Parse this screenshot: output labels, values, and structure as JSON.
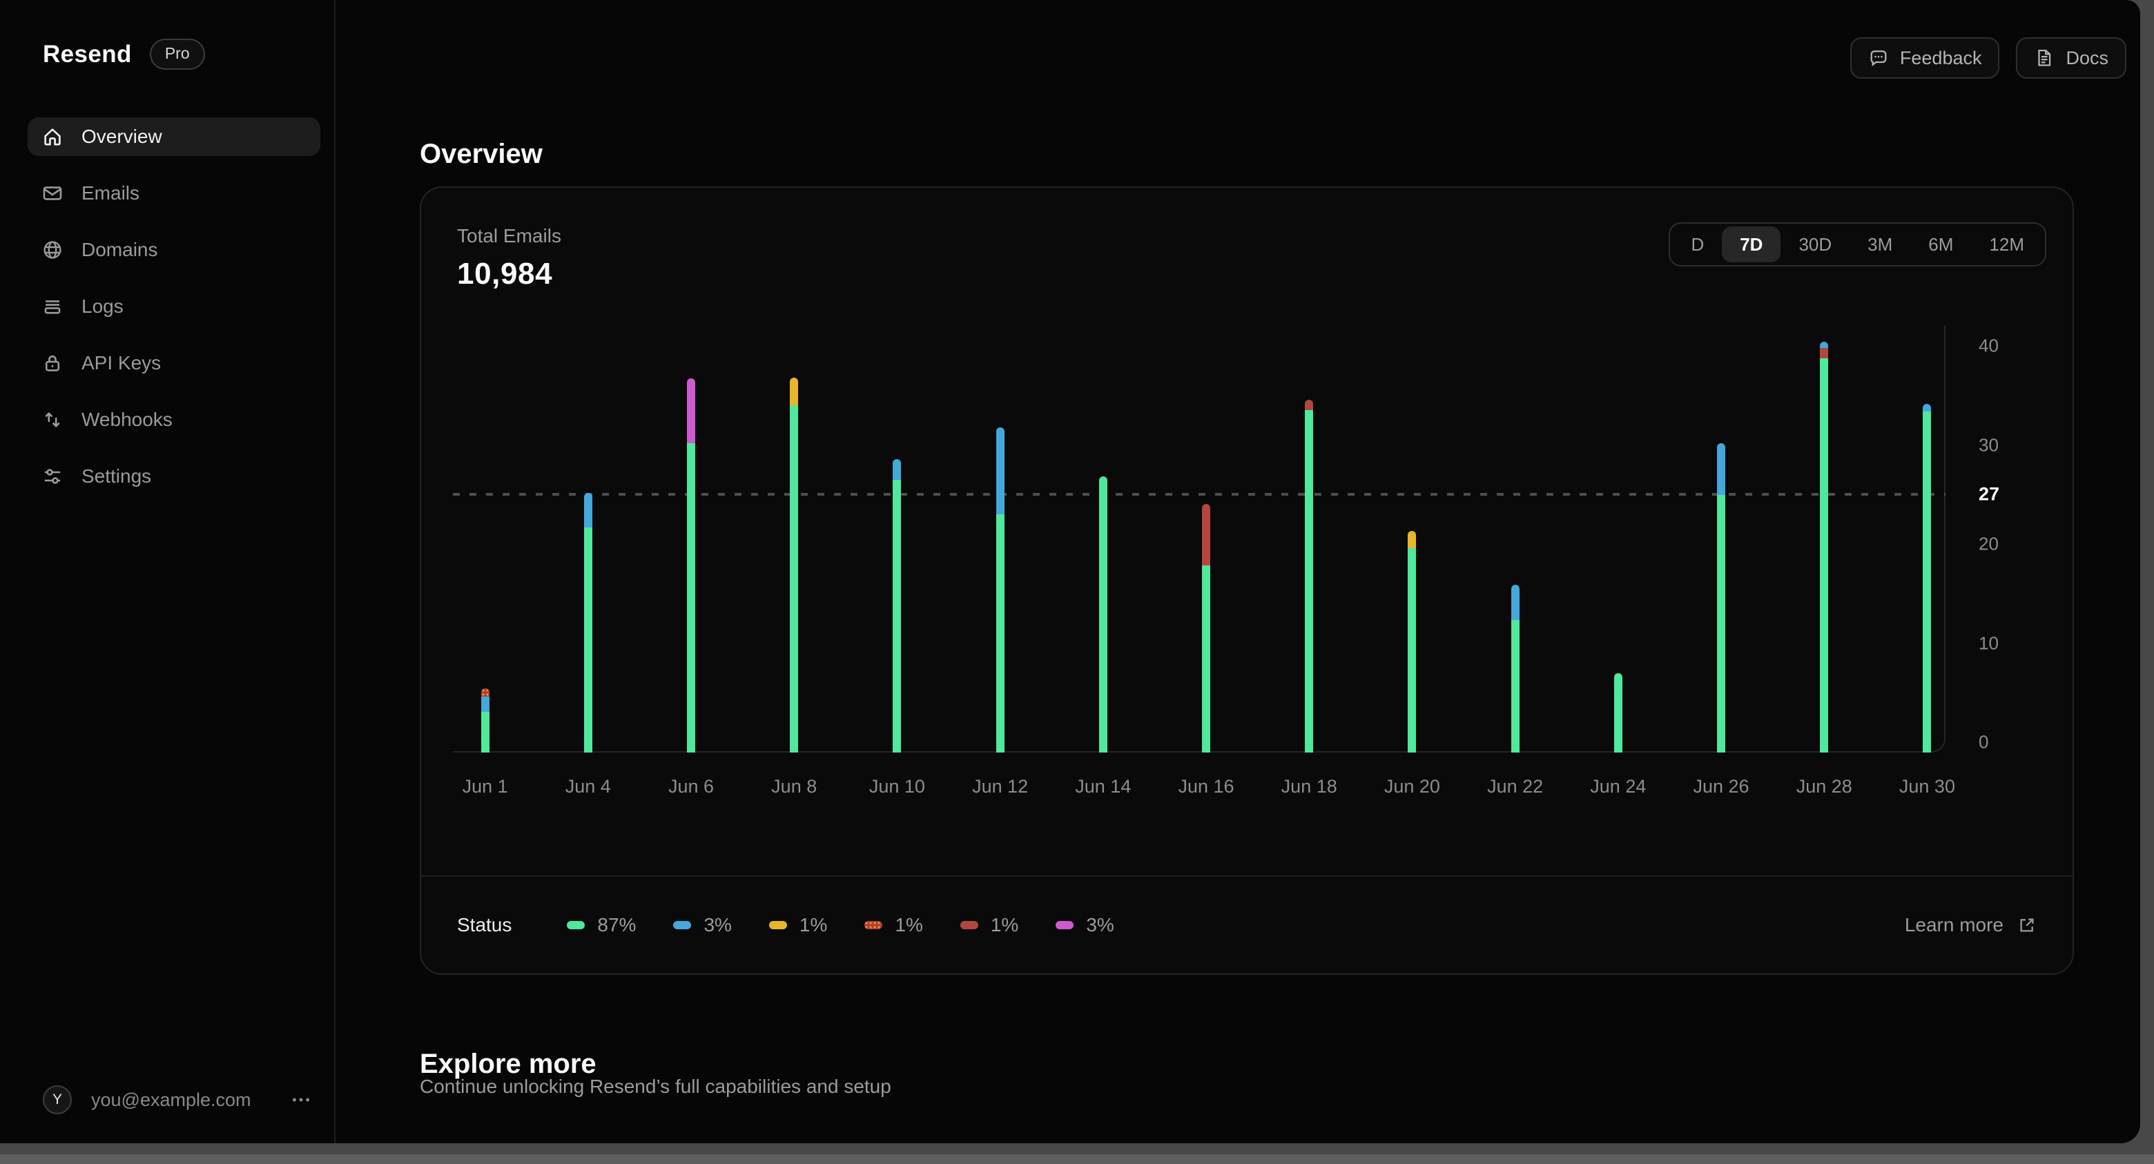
{
  "sidebar": {
    "logo": "Resend",
    "badge": "Pro",
    "items": [
      {
        "label": "Overview",
        "icon": "home-icon",
        "selected": true
      },
      {
        "label": "Emails",
        "icon": "mail-icon",
        "selected": false
      },
      {
        "label": "Domains",
        "icon": "globe-icon",
        "selected": false
      },
      {
        "label": "Logs",
        "icon": "logs-icon",
        "selected": false
      },
      {
        "label": "API Keys",
        "icon": "lock-icon",
        "selected": false
      },
      {
        "label": "Webhooks",
        "icon": "arrows-up-down-icon",
        "selected": false
      },
      {
        "label": "Settings",
        "icon": "sliders-icon",
        "selected": false
      }
    ],
    "user": {
      "avatar_initial": "Y",
      "email": "you@example.com"
    }
  },
  "header": {
    "feedback_label": "Feedback",
    "docs_label": "Docs"
  },
  "page": {
    "title": "Overview"
  },
  "overview_card": {
    "metric_label": "Total Emails",
    "metric_value": "10,984",
    "ranges": [
      {
        "label": "D",
        "selected": false
      },
      {
        "label": "7D",
        "selected": true
      },
      {
        "label": "30D",
        "selected": false
      },
      {
        "label": "3M",
        "selected": false
      },
      {
        "label": "6M",
        "selected": false
      },
      {
        "label": "12M",
        "selected": false
      }
    ],
    "legend": {
      "title": "Status",
      "entries": [
        {
          "color_key": "green",
          "pct": "87%"
        },
        {
          "color_key": "blue",
          "pct": "3%"
        },
        {
          "color_key": "yellow",
          "pct": "1%"
        },
        {
          "color_key": "orange",
          "pct": "1%"
        },
        {
          "color_key": "red",
          "pct": "1%"
        },
        {
          "color_key": "magenta",
          "pct": "3%"
        }
      ],
      "learn_more": "Learn more"
    }
  },
  "explore": {
    "title": "Explore more",
    "subtitle": "Continue unlocking Resend’s full capabilities and setup"
  },
  "chart_data": {
    "type": "bar",
    "stacked": true,
    "title": "Total Emails",
    "total": 10984,
    "ylim": [
      0,
      40
    ],
    "y_ticks": [
      0,
      10,
      20,
      30,
      40
    ],
    "reference_line_value": 27,
    "grid": "dashed-reference-only",
    "legend_position": "bottom",
    "colors": {
      "green": "#4fe89c",
      "blue": "#44a8da",
      "yellow": "#e8b62c",
      "orange": "#b0402c",
      "red": "#b3473e",
      "magenta": "#cd5ad0"
    },
    "bars": [
      {
        "label": "Jun 1",
        "segments": [
          {
            "c": "green",
            "v": 4
          },
          {
            "c": "blue",
            "v": 1.5
          },
          {
            "c": "orange",
            "v": 0.75
          }
        ]
      },
      {
        "label": "Jun 4",
        "segments": [
          {
            "c": "green",
            "v": 22
          },
          {
            "c": "blue",
            "v": 3.4
          }
        ]
      },
      {
        "label": "Jun 6",
        "segments": [
          {
            "c": "green",
            "v": 30.3
          },
          {
            "c": "magenta",
            "v": 6.3
          }
        ]
      },
      {
        "label": "Jun 8",
        "segments": [
          {
            "c": "green",
            "v": 34
          },
          {
            "c": "yellow",
            "v": 2.7
          }
        ]
      },
      {
        "label": "Jun 10",
        "segments": [
          {
            "c": "green",
            "v": 26.7
          },
          {
            "c": "blue",
            "v": 2
          }
        ]
      },
      {
        "label": "Jun 12",
        "segments": [
          {
            "c": "green",
            "v": 23.3
          },
          {
            "c": "blue",
            "v": 8.5
          }
        ]
      },
      {
        "label": "Jun 14",
        "segments": [
          {
            "c": "green",
            "v": 27
          }
        ]
      },
      {
        "label": "Jun 16",
        "segments": [
          {
            "c": "green",
            "v": 18.3
          },
          {
            "c": "red",
            "v": 6
          }
        ]
      },
      {
        "label": "Jun 18",
        "segments": [
          {
            "c": "green",
            "v": 33.5
          },
          {
            "c": "red",
            "v": 1
          }
        ]
      },
      {
        "label": "Jun 20",
        "segments": [
          {
            "c": "green",
            "v": 20
          },
          {
            "c": "yellow",
            "v": 1.7
          }
        ]
      },
      {
        "label": "Jun 22",
        "segments": [
          {
            "c": "green",
            "v": 13
          },
          {
            "c": "blue",
            "v": 3.4
          }
        ]
      },
      {
        "label": "Jun 24",
        "segments": [
          {
            "c": "green",
            "v": 7.8
          }
        ]
      },
      {
        "label": "Jun 26",
        "segments": [
          {
            "c": "green",
            "v": 25.2
          },
          {
            "c": "blue",
            "v": 5.1
          }
        ]
      },
      {
        "label": "Jun 28",
        "segments": [
          {
            "c": "green",
            "v": 38.6
          },
          {
            "c": "red",
            "v": 1
          },
          {
            "c": "blue",
            "v": 0.6
          }
        ]
      },
      {
        "label": "Jun 30",
        "segments": [
          {
            "c": "green",
            "v": 33.4
          },
          {
            "c": "blue",
            "v": 0.7
          }
        ]
      }
    ]
  }
}
